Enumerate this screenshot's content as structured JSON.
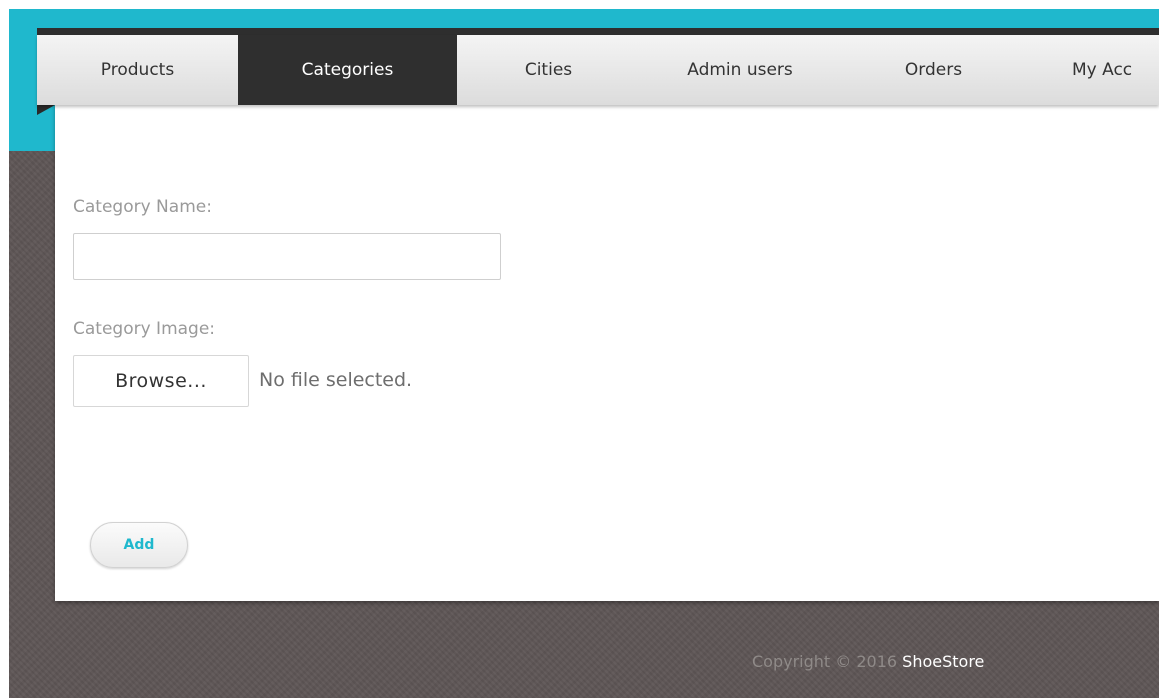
{
  "nav": {
    "tabs": [
      {
        "label": "Products",
        "active": false
      },
      {
        "label": "Categories",
        "active": true
      },
      {
        "label": "Cities",
        "active": false
      },
      {
        "label": "Admin users",
        "active": false
      },
      {
        "label": "Orders",
        "active": false
      },
      {
        "label": "My Acc",
        "active": false
      }
    ]
  },
  "form": {
    "category_name_label": "Category Name:",
    "category_name_value": "",
    "category_image_label": "Category Image:",
    "browse_label": "Browse...",
    "file_status": "No file selected.",
    "add_label": "Add"
  },
  "footer": {
    "copyright_text": "Copyright © 2016",
    "brand": "ShoeStore"
  },
  "colors": {
    "accent_teal": "#1fb8cd",
    "active_tab_bg": "#2f2f2f",
    "page_background": "#5e5656"
  }
}
